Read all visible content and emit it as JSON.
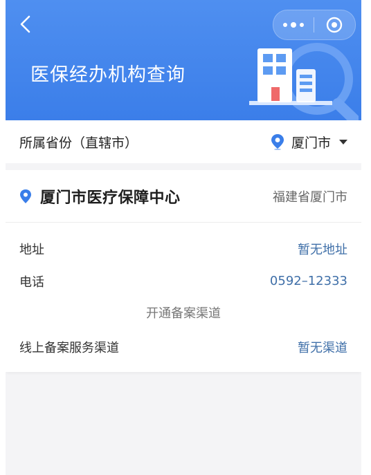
{
  "header": {
    "title": "医保经办机构查询",
    "back_icon": "chevron-left-icon",
    "more_icon": "more-dots-icon",
    "close_icon": "target-close-icon"
  },
  "province": {
    "label": "所属省份（直辖市）",
    "selected_city": "厦门市",
    "pin_color": "#3a7ee9"
  },
  "card": {
    "name": "厦门市医疗保障中心",
    "region": "福建省厦门市",
    "rows": [
      {
        "key": "地址",
        "value": "暂无地址"
      },
      {
        "key": "电话",
        "value": "0592–12333"
      }
    ],
    "section_title": "开通备案渠道",
    "channel_row": {
      "key": "线上备案服务渠道",
      "value": "暂无渠道"
    }
  },
  "colors": {
    "header_blue": "#4a8cf0",
    "link_blue": "#3f6fa8",
    "background": "#f4f4f6"
  }
}
